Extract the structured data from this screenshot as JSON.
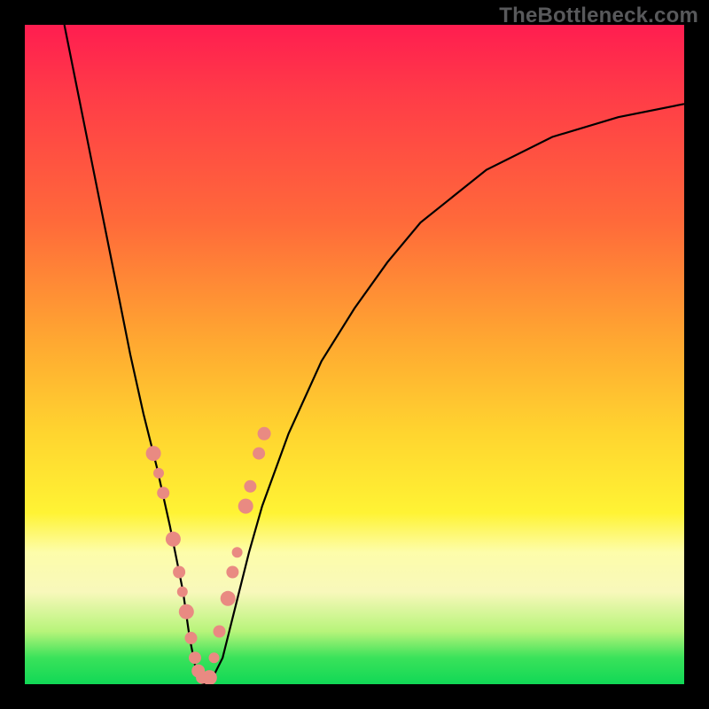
{
  "watermark": "TheBottleneck.com",
  "chart_data": {
    "type": "line",
    "title": "",
    "xlabel": "",
    "ylabel": "",
    "xlim": [
      0,
      100
    ],
    "ylim": [
      0,
      100
    ],
    "grid": false,
    "series": [
      {
        "name": "curve",
        "x": [
          6,
          8,
          10,
          12,
          14,
          16,
          18,
          20,
          22,
          24,
          25,
          26,
          27,
          28,
          30,
          32,
          34,
          36,
          40,
          45,
          50,
          55,
          60,
          65,
          70,
          80,
          90,
          100
        ],
        "y": [
          100,
          90,
          80,
          70,
          60,
          50,
          41,
          33,
          24,
          14,
          7,
          2,
          0,
          0,
          4,
          12,
          20,
          27,
          38,
          49,
          57,
          64,
          70,
          74,
          78,
          83,
          86,
          88
        ]
      }
    ],
    "highlight_clusters": [
      {
        "name": "left-branch-markers",
        "x": [
          19.5,
          20.3,
          21.0,
          22.5,
          23.4,
          23.9,
          24.5,
          25.2,
          25.8,
          26.3,
          26.9
        ],
        "y": [
          35,
          32,
          29,
          22,
          17,
          14,
          11,
          7,
          4,
          2,
          1
        ]
      },
      {
        "name": "right-branch-markers",
        "x": [
          28.0,
          28.7,
          29.5,
          30.8,
          31.5,
          32.2,
          33.5,
          34.2,
          35.5,
          36.3
        ],
        "y": [
          1,
          4,
          8,
          13,
          17,
          20,
          27,
          30,
          35,
          38
        ]
      }
    ],
    "colors": {
      "curve": "#000000",
      "markers": "#e98a82",
      "gradient_top": "#ff1d50",
      "gradient_mid": "#ffd52f",
      "gradient_bottom": "#11d856"
    }
  }
}
